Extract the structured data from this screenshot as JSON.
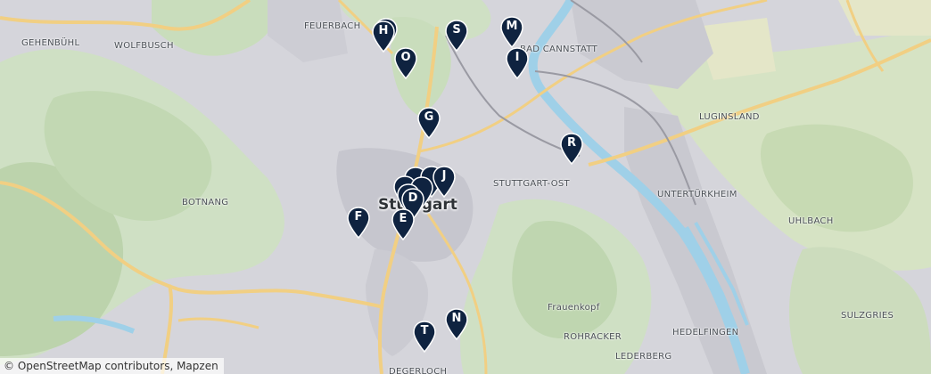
{
  "map": {
    "places": {
      "gehenbuehl": "GEHENBÜHL",
      "wolfbusch": "WOLFBUSCH",
      "feuerbach": "FEUERBACH",
      "bad_cannstatt": "BAD CANNSTATT",
      "luginsland": "LUGINSLAND",
      "stuttgart_ost": "STUTTGART-OST",
      "untertuerkheim": "UNTERTÜRKHEIM",
      "botnang": "BOTNANG",
      "uhlbach": "UHLBACH",
      "frauenkopf": "Frauenkopf",
      "rohracker": "ROHRACKER",
      "hedelfingen": "HEDELFINGEN",
      "sulzgries": "SULZGRIES",
      "lederberg": "LEDERBERG",
      "degerloch": "DEGERLOCH",
      "city": "Stuttgart"
    },
    "markers": {
      "h": "H",
      "o": "O",
      "s": "S",
      "m": "M",
      "i": "I",
      "g": "G",
      "r": "R",
      "j": "J",
      "d": "D",
      "e": "E",
      "f": "F",
      "t": "T",
      "n": "N"
    },
    "marker_color": "#0f2340",
    "attribution": "© OpenStreetMap contributors, Mapzen"
  }
}
